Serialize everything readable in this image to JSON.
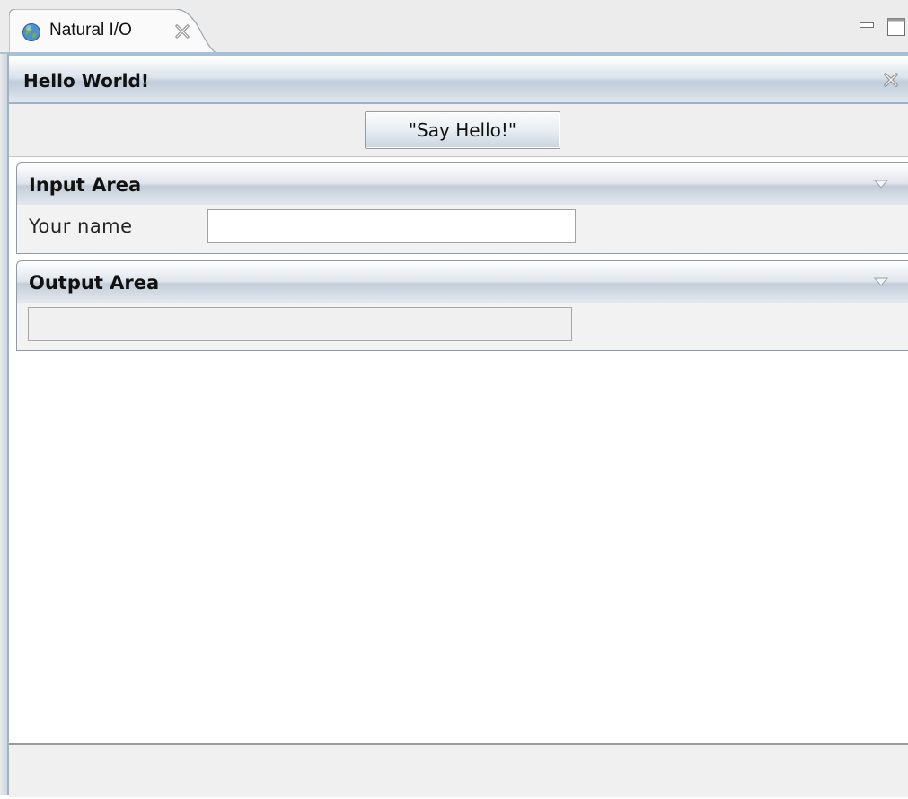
{
  "tab": {
    "label": "Natural I/O",
    "icon": "globe-icon",
    "close_icon": "close-icon"
  },
  "window_controls": {
    "minimize_icon": "minimize-icon",
    "maximize_icon": "maximize-icon"
  },
  "header": {
    "title": "Hello World!",
    "close_icon": "close-icon"
  },
  "toolbar": {
    "say_hello_label": "\"Say Hello!\""
  },
  "input_area": {
    "title": "Input Area",
    "toggle_icon": "triangle-down-icon",
    "name_label": "Your name",
    "name_value": ""
  },
  "output_area": {
    "title": "Output Area",
    "toggle_icon": "triangle-down-icon",
    "output_value": ""
  },
  "status_bar": {
    "text": ""
  },
  "colors": {
    "accent_blue": "#a9bfd6",
    "header_gradient_mid": "#c0ccd9",
    "panel_background": "#f2f2f2"
  }
}
